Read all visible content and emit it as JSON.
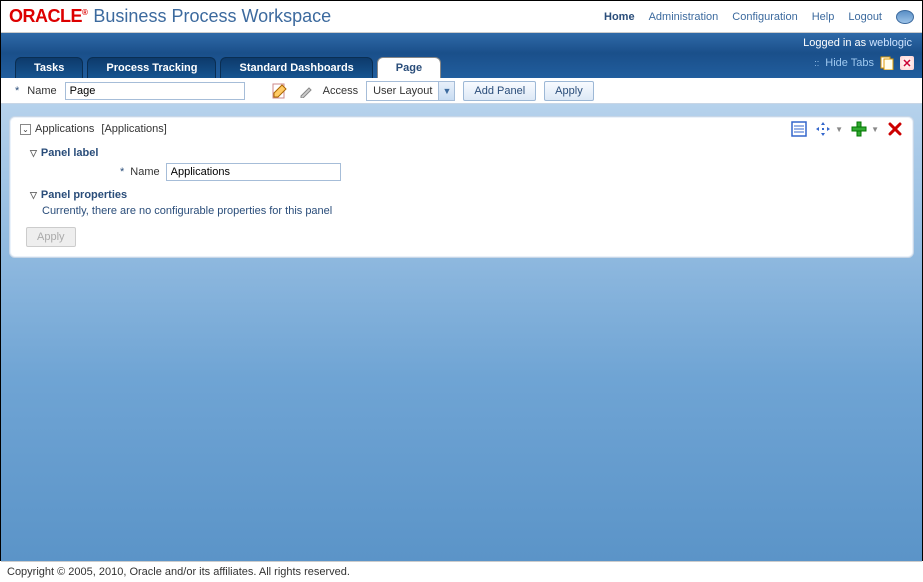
{
  "header": {
    "brand": "ORACLE",
    "title": "Business Process Workspace",
    "nav": {
      "home": "Home",
      "admin": "Administration",
      "config": "Configuration",
      "help": "Help",
      "logout": "Logout"
    }
  },
  "userbar": {
    "logged_in_as": "Logged in as",
    "user": "weblogic"
  },
  "tabs": {
    "tasks": "Tasks",
    "process_tracking": "Process Tracking",
    "standard_dashboards": "Standard Dashboards",
    "page": "Page",
    "hide_tabs": "Hide Tabs"
  },
  "toolbar": {
    "name_label": "Name",
    "name_value": "Page",
    "access_label": "Access",
    "access_value": "User Layout",
    "add_panel": "Add Panel",
    "apply": "Apply"
  },
  "panel": {
    "breadcrumb_app": "Applications",
    "breadcrumb_detail": "[Applications]",
    "label_section": "Panel label",
    "name_label": "Name",
    "name_value": "Applications",
    "props_section": "Panel properties",
    "props_note": "Currently, there are no configurable properties for this panel",
    "apply": "Apply"
  },
  "footer": {
    "copyright": "Copyright © 2005, 2010, Oracle and/or its affiliates. All rights reserved."
  }
}
